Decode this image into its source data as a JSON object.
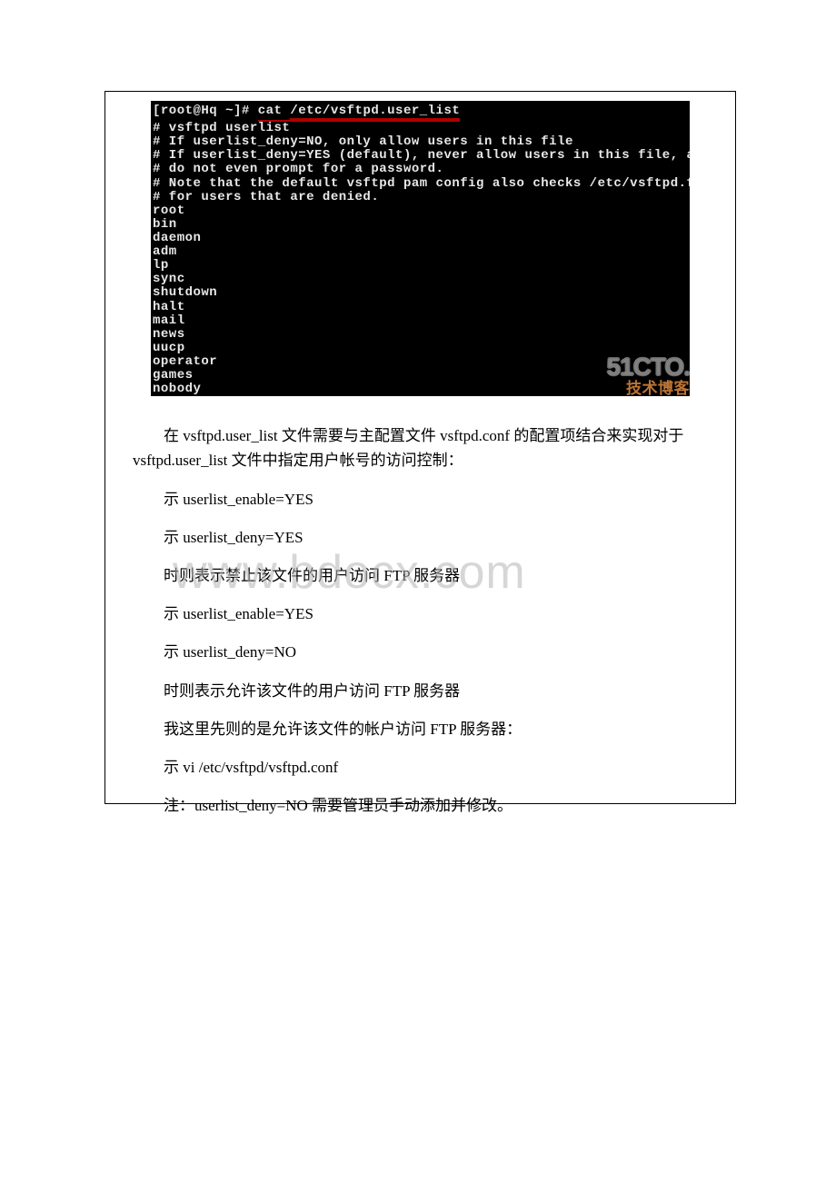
{
  "terminal": {
    "prompt_prefix": "[root@Hq ~]# ",
    "command": "cat /etc/vsftpd.user_list",
    "lines": [
      "# vsftpd userlist",
      "# If userlist_deny=NO, only allow users in this file",
      "# If userlist_deny=YES (default), never allow users in this file, a",
      "# do not even prompt for a password.",
      "# Note that the default vsftpd pam config also checks /etc/vsftpd.f",
      "# for users that are denied.",
      "root",
      "bin",
      "daemon",
      "adm",
      "lp",
      "sync",
      "shutdown",
      "halt",
      "mail",
      "news",
      "uucp",
      "operator",
      "games",
      "nobody"
    ],
    "wm1": "51CTO.",
    "wm2": "技术博客"
  },
  "body": {
    "p1": "在 vsftpd.user_list 文件需要与主配置文件 vsftpd.conf 的配置项结合来实现对于 vsftpd.user_list 文件中指定用户帐号的访问控制：",
    "p2": "示 userlist_enable=YES",
    "p3": "示 userlist_deny=YES",
    "p4": "时则表示禁止该文件的用户访问 FTP 服务器",
    "p5": "示 userlist_enable=YES",
    "p6": "示 userlist_deny=NO",
    "p7": "时则表示允许该文件的用户访问 FTP 服务器",
    "p8": "我这里先则的是允许该文件的帐户访问 FTP 服务器：",
    "p9": "示 vi  /etc/vsftpd/vsftpd.conf",
    "p10": "注：userlist_deny=NO 需要管理员手动添加并修改。"
  },
  "watermark": "www.bdocx.com"
}
